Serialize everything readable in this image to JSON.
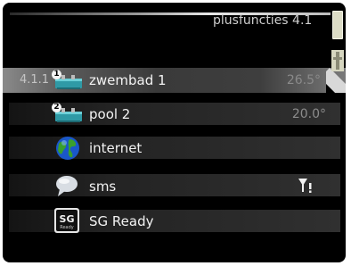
{
  "header": {
    "title": "plusfuncties 4.1"
  },
  "menu": {
    "items": [
      {
        "prefix": "4.1.1",
        "badge": "1",
        "label": "zwembad 1",
        "value": "26.5°",
        "icon": "pool-heater-icon",
        "selected": true
      },
      {
        "prefix": "",
        "badge": "2",
        "label": "pool 2",
        "value": "20.0°",
        "icon": "pool-heater-icon"
      },
      {
        "prefix": "",
        "badge": "",
        "label": "internet",
        "value": "",
        "icon": "globe-icon"
      },
      {
        "prefix": "",
        "badge": "",
        "label": "sms",
        "value": "",
        "icon": "speech-bubble-icon",
        "status_icon": "signal-warning-icon"
      },
      {
        "prefix": "",
        "badge": "",
        "label": "SG Ready",
        "value": "",
        "icon": "sg-ready-icon",
        "icon_text": "SG",
        "icon_subtext": "Ready"
      }
    ]
  },
  "colors": {
    "screen_bg": "#000000",
    "row_selected": "#5a5a5a",
    "text": "#f2f2f2",
    "value_text": "#8c8c8c",
    "pool_icon": "#2f9aa6",
    "globe_blue": "#1a57c9",
    "globe_green": "#3aa02c"
  }
}
